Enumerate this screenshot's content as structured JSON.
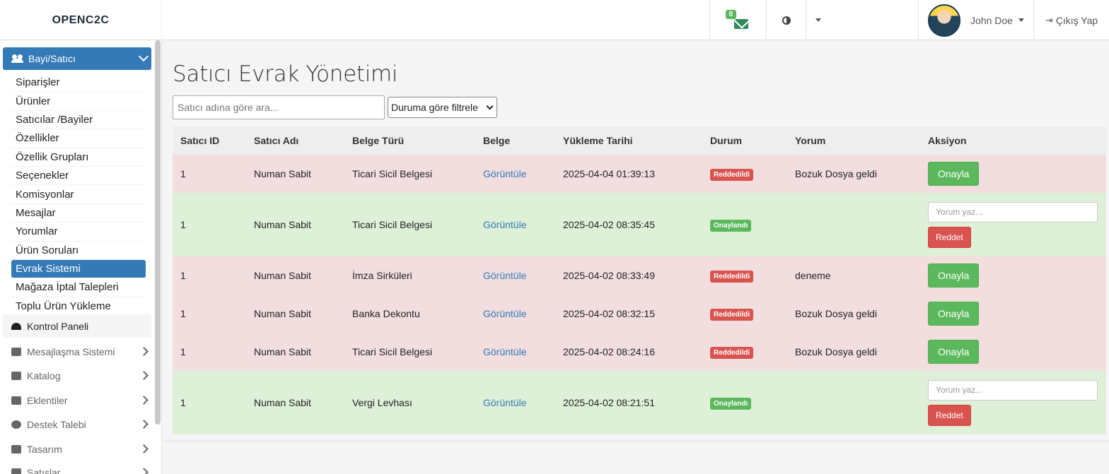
{
  "header": {
    "brand": "OPENC2C",
    "mail_count": "0",
    "user_name": "John Doe",
    "logout_label": "Çıkış Yap"
  },
  "sidebar": {
    "active_section": "Bayi/Satıcı",
    "submenu": [
      "Siparişler",
      "Ürünler",
      "Satıcılar /Bayiler",
      "Özellikler",
      "Özellik Grupları",
      "Seçenekler",
      "Komisyonlar",
      "Mesajlar",
      "Yorumlar",
      "Ürün Soruları",
      "Evrak Sistemi",
      "Mağaza İptal Talepleri",
      "Toplu Ürün Yükleme"
    ],
    "active_item": "Evrak Sistemi",
    "kontrol_panel": "Kontrol Paneli",
    "menu": [
      "Mesajlaşma Sistemi",
      "Katalog",
      "Eklentiler",
      "Destek Talebi",
      "Tasarım",
      "Satışlar"
    ]
  },
  "main": {
    "title": "Satıcı Evrak Yönetimi",
    "search_placeholder": "Satıcı adına göre ara...",
    "filter_label": "Duruma göre filtrele",
    "columns": [
      "Satıcı ID",
      "Satıcı Adı",
      "Belge Türü",
      "Belge",
      "Yükleme Tarihi",
      "Durum",
      "Yorum",
      "Aksiyon"
    ],
    "rows": [
      {
        "id": "1",
        "name": "Numan Sabit",
        "type": "Ticari Sicil Belgesi",
        "doc": "Görüntüle",
        "date": "2025-04-04 01:39:13",
        "status": "Reddedildi",
        "comment": "Bozuk Dosya geldi",
        "action": "Onayla"
      },
      {
        "id": "1",
        "name": "Numan Sabit",
        "type": "Ticari Sicil Belgesi",
        "doc": "Görüntüle",
        "date": "2025-04-02 08:35:45",
        "status": "Onaylandı",
        "comment": "",
        "action": "Reddet",
        "comment_placeholder": "Yorum yaz..."
      },
      {
        "id": "1",
        "name": "Numan Sabit",
        "type": "İmza Sirküleri",
        "doc": "Görüntüle",
        "date": "2025-04-02 08:33:49",
        "status": "Reddedildi",
        "comment": "deneme",
        "action": "Onayla"
      },
      {
        "id": "1",
        "name": "Numan Sabit",
        "type": "Banka Dekontu",
        "doc": "Görüntüle",
        "date": "2025-04-02 08:32:15",
        "status": "Reddedildi",
        "comment": "Bozuk Dosya geldi",
        "action": "Onayla"
      },
      {
        "id": "1",
        "name": "Numan Sabit",
        "type": "Ticari Sicil Belgesi",
        "doc": "Görüntüle",
        "date": "2025-04-02 08:24:16",
        "status": "Reddedildi",
        "comment": "Bozuk Dosya geldi",
        "action": "Onayla"
      },
      {
        "id": "1",
        "name": "Numan Sabit",
        "type": "Vergi Levhası",
        "doc": "Görüntüle",
        "date": "2025-04-02 08:21:51",
        "status": "Onaylandı",
        "comment": "",
        "action": "Reddet",
        "comment_placeholder": "Yorum yaz..."
      }
    ]
  },
  "colors": {
    "primary": "#337ab7",
    "success": "#5cb85c",
    "danger": "#d9534f",
    "row_rejected": "#f2dede",
    "row_approved": "#dff0d8"
  }
}
